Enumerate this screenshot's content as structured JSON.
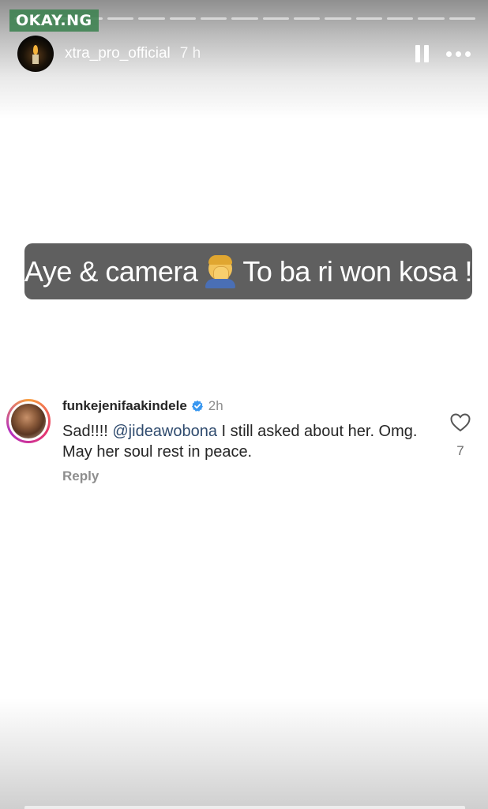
{
  "watermark": "OKAY.NG",
  "story": {
    "progress": {
      "segments_total": 15,
      "current_segment": 2
    },
    "header": {
      "username": "xtra_pro_official",
      "time": "7 h",
      "pause_icon": "pause-icon",
      "more_icon": "more-options-icon"
    },
    "caption": {
      "text_before": "Aye & camera",
      "emoji": "facepalm-emoji",
      "text_after": "To ba ri won kosa !"
    }
  },
  "comment": {
    "username": "funkejenifaakindele",
    "verified": true,
    "time": "2h",
    "text_prefix": "Sad!!!! ",
    "mention": "@jideawobona",
    "text_suffix": " I still asked about her. Omg. May her soul rest in peace.",
    "reply_label": "Reply",
    "likes": "7"
  },
  "colors": {
    "caption_bg": "#5f5f5f",
    "verified_blue": "#3897f0",
    "mention": "#2f4b6e",
    "watermark_bg": "#3c8250"
  }
}
